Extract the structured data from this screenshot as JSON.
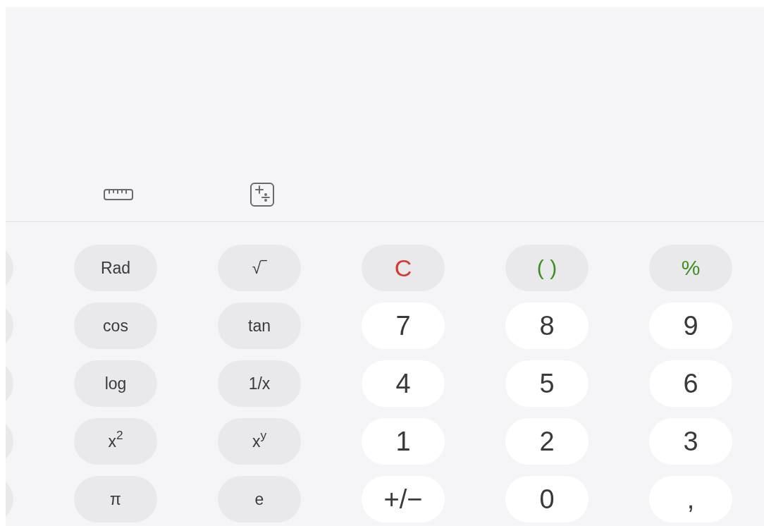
{
  "toolbar": {
    "icons": [
      {
        "kind": "ruler"
      },
      {
        "kind": "converter"
      }
    ]
  },
  "keypad": {
    "rows": [
      [
        {
          "label": "Rad",
          "kind": "function"
        },
        {
          "label": "√‾",
          "kind": "function"
        },
        {
          "label": "C",
          "kind": "clear"
        },
        {
          "label": "( )",
          "kind": "operator"
        },
        {
          "label": "%",
          "kind": "operator"
        }
      ],
      [
        {
          "label": "cos",
          "kind": "function"
        },
        {
          "label": "tan",
          "kind": "function"
        },
        {
          "label": "7",
          "kind": "digit"
        },
        {
          "label": "8",
          "kind": "digit"
        },
        {
          "label": "9",
          "kind": "digit"
        }
      ],
      [
        {
          "label": "log",
          "kind": "function"
        },
        {
          "label": "1/x",
          "kind": "function"
        },
        {
          "label": "4",
          "kind": "digit"
        },
        {
          "label": "5",
          "kind": "digit"
        },
        {
          "label": "6",
          "kind": "digit"
        }
      ],
      [
        {
          "label": "x$^{2}$",
          "kind": "function"
        },
        {
          "label": "x$^{y}$",
          "kind": "function"
        },
        {
          "label": "1",
          "kind": "digit"
        },
        {
          "label": "2",
          "kind": "digit"
        },
        {
          "label": "3",
          "kind": "digit"
        }
      ],
      [
        {
          "label": "π",
          "kind": "function"
        },
        {
          "label": "e",
          "kind": "function"
        },
        {
          "label": "+/−",
          "kind": "digit"
        },
        {
          "label": "0",
          "kind": "digit"
        },
        {
          "label": ",",
          "kind": "digit"
        }
      ]
    ]
  }
}
